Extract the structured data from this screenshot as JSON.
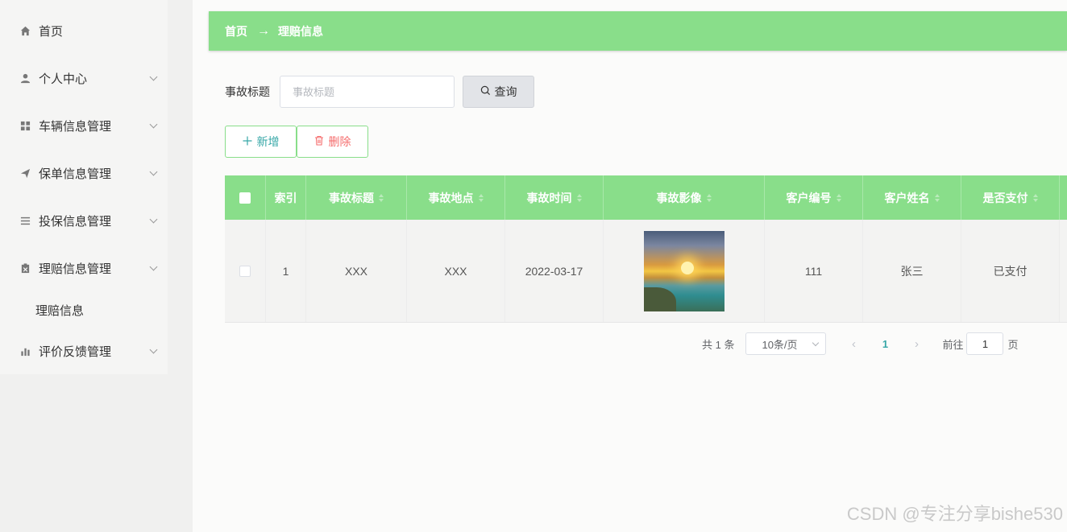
{
  "sidebar": {
    "items": [
      {
        "label": "首页",
        "icon": "home-icon"
      },
      {
        "label": "个人中心",
        "icon": "user-icon"
      },
      {
        "label": "车辆信息管理",
        "icon": "grid-icon"
      },
      {
        "label": "保单信息管理",
        "icon": "send-icon"
      },
      {
        "label": "投保信息管理",
        "icon": "list-icon"
      },
      {
        "label": "理赔信息管理",
        "icon": "clipboard-icon"
      },
      {
        "label": "评价反馈管理",
        "icon": "bar-chart-icon"
      }
    ],
    "subitem": "理赔信息"
  },
  "breadcrumb": {
    "home": "首页",
    "separator": "→",
    "current": "理赔信息"
  },
  "search": {
    "label": "事故标题",
    "placeholder": "事故标题",
    "button": "查询"
  },
  "actions": {
    "add": "新增",
    "delete": "删除"
  },
  "table": {
    "columns": [
      "索引",
      "事故标题",
      "事故地点",
      "事故时间",
      "事故影像",
      "客户编号",
      "客户姓名",
      "是否支付"
    ],
    "rows": [
      {
        "index": "1",
        "title": "XXX",
        "location": "XXX",
        "time": "2022-03-17",
        "image": "accident-photo",
        "customer_no": "111",
        "customer_name": "张三",
        "paid": "已支付"
      }
    ]
  },
  "pagination": {
    "total": "共 1 条",
    "page_size": "10条/页",
    "current_page": "1",
    "goto_label": "前往",
    "goto_value": "1",
    "page_suffix": "页"
  },
  "watermark": "CSDN @专注分享bishe530",
  "colors": {
    "accent": "#89de8a",
    "text_accent": "#37a7a7",
    "danger": "#f56c6c"
  }
}
